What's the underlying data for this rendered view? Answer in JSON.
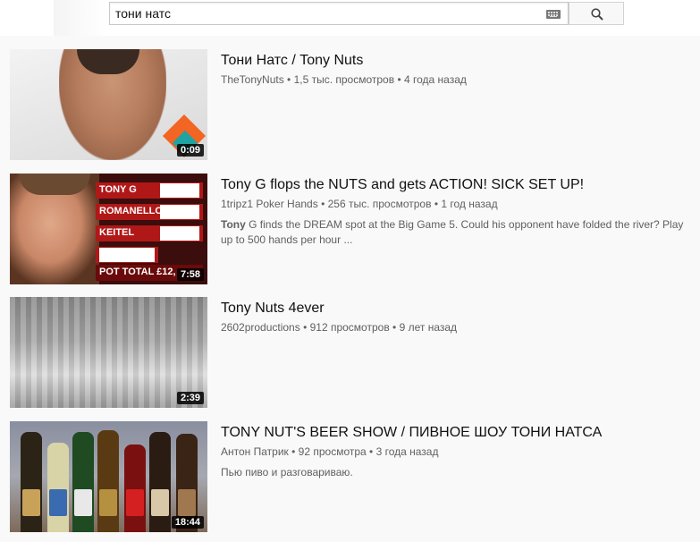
{
  "search": {
    "value": "тони натс"
  },
  "results": [
    {
      "title": "Тони Натс / Tony Nuts",
      "channel": "TheTonyNuts",
      "views": "1,5 тыс. просмотров",
      "age": "4 года назад",
      "duration": "0:09",
      "description_bold": "",
      "description": ""
    },
    {
      "title": "Tony G flops the NUTS and gets ACTION! SICK SET UP!",
      "channel": "1tripz1 Poker Hands",
      "views": "256 тыс. просмотров",
      "age": "1 год назад",
      "duration": "7:58",
      "description_bold": "Tony",
      "description": " G finds the DREAM spot at the Big Game 5. Could his opponent have folded the river? Play up to 500 hands per hour ...",
      "thumb_rows": [
        "TONY G",
        "ROMANELLO",
        "KEITEL",
        "",
        "POT TOTAL  £12,"
      ]
    },
    {
      "title": "Tony Nuts 4ever",
      "channel": "2602productions",
      "views": "912 просмотров",
      "age": "9 лет назад",
      "duration": "2:39",
      "description_bold": "",
      "description": ""
    },
    {
      "title": "TONY NUT'S BEER SHOW / ПИВНОЕ ШОУ ТОНИ НАТСА",
      "channel": "Антон Патрик",
      "views": "92 просмотра",
      "age": "3 года назад",
      "duration": "18:44",
      "description_bold": "",
      "description": "Пью пиво и разговариваю."
    }
  ],
  "separator": " • ",
  "colors": {
    "background": "#f9f9f9",
    "meta_text": "#606060",
    "title_text": "#111111"
  }
}
